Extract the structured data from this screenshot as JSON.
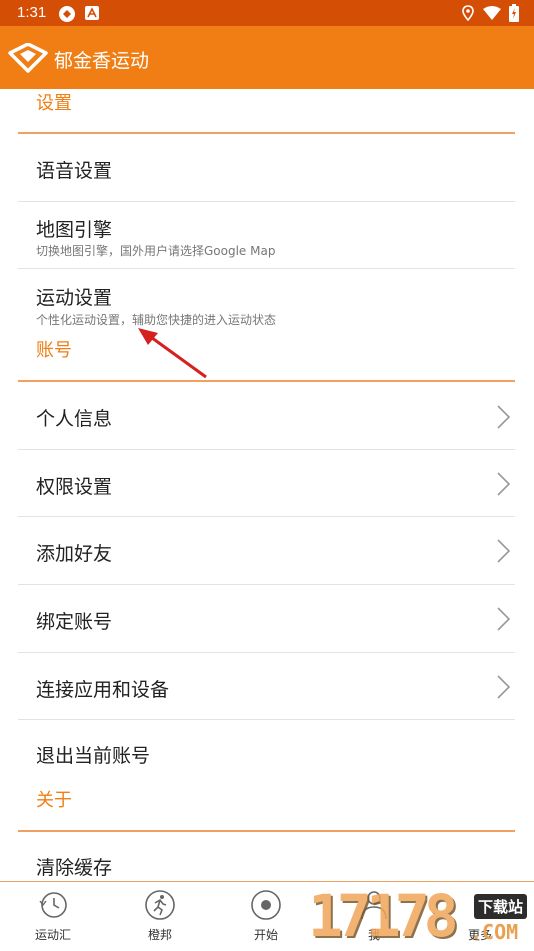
{
  "status_bar": {
    "time": "1:31"
  },
  "app_bar": {
    "title": "郁金香运动"
  },
  "sections": {
    "settings_title": "设置",
    "account_title": "账号",
    "about_title": "关于"
  },
  "settings_items": {
    "voice": "语音设置",
    "map_engine": "地图引擎",
    "map_engine_sub": "切换地图引擎，国外用户请选择Google Map",
    "sport": "运动设置",
    "sport_sub": "个性化运动设置，辅助您快捷的进入运动状态"
  },
  "account_items": {
    "profile": "个人信息",
    "permissions": "权限设置",
    "add_friend": "添加好友",
    "bind_account": "绑定账号",
    "connect": "连接应用和设备",
    "logout": "退出当前账号"
  },
  "about_items": {
    "clear_cache": "清除缓存"
  },
  "bottom_nav": {
    "items": [
      "运动汇",
      "橙邦",
      "开始",
      "我",
      "更多"
    ]
  },
  "watermark": {
    "number": "17178",
    "site": "下载站",
    "domain": ".COM"
  },
  "colors": {
    "accent": "#f07e14",
    "status_bar": "#d44e06",
    "annotation_arrow": "#d62020"
  }
}
